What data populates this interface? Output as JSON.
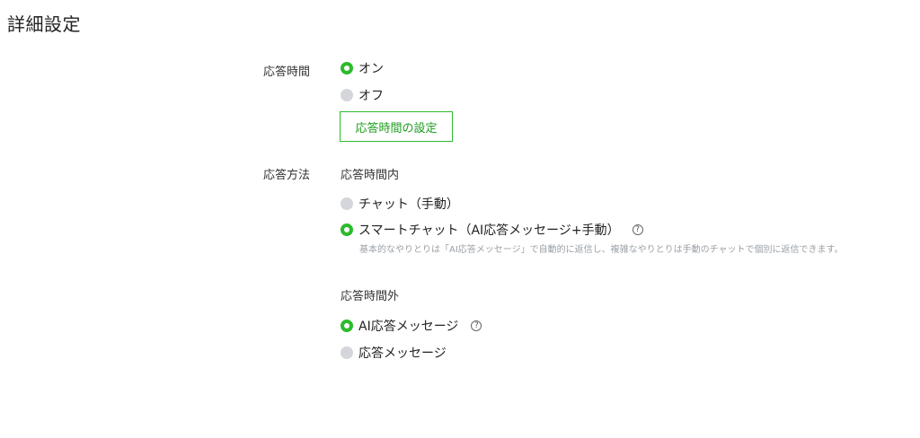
{
  "page": {
    "title": "詳細設定"
  },
  "response_time": {
    "label": "応答時間",
    "options": [
      {
        "label": "オン",
        "selected": true
      },
      {
        "label": "オフ",
        "selected": false
      }
    ],
    "settings_button": "応答時間の設定"
  },
  "response_method": {
    "label": "応答方法",
    "within_hours": {
      "heading": "応答時間内",
      "options": [
        {
          "label": "チャット（手動）",
          "selected": false
        },
        {
          "label": "スマートチャット（AI応答メッセージ+手動）",
          "selected": true,
          "help": "?"
        }
      ],
      "description": "基本的なやりとりは「AI応答メッセージ」で自動的に返信し、複雑なやりとりは手動のチャットで個別に返信できます。"
    },
    "outside_hours": {
      "heading": "応答時間外",
      "options": [
        {
          "label": "AI応答メッセージ",
          "selected": true,
          "help": "?"
        },
        {
          "label": "応答メッセージ",
          "selected": false
        }
      ]
    }
  },
  "colors": {
    "accent": "#2dba2d",
    "radio_off": "#d4d6db",
    "description": "#9aa0a6"
  }
}
